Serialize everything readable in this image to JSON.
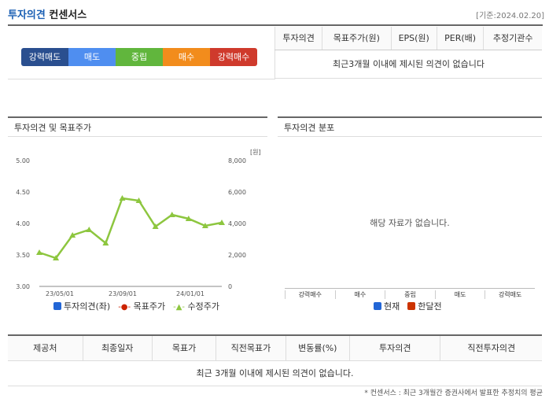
{
  "header": {
    "title_main": "투자의견",
    "title_sub": "컨센서스",
    "as_of": "[기준:2024.02.20]"
  },
  "rating_scale": {
    "items": [
      "강력매도",
      "매도",
      "중립",
      "매수",
      "강력매수"
    ],
    "colors": [
      "#2a4f8f",
      "#4f8ef0",
      "#61b63d",
      "#f28c1c",
      "#cf3a2c"
    ]
  },
  "consensus_table": {
    "columns": [
      "투자의견",
      "목표주가(원)",
      "EPS(원)",
      "PER(배)",
      "추정기관수"
    ],
    "empty_message": "최근3개월 이내에 제시된 의견이 없습니다"
  },
  "opinion_chart": {
    "panel_title": "투자의견 및 목표주가",
    "unit_label": "[원]",
    "legend": [
      "투자의견(좌)",
      "목표주가",
      "수정주가"
    ],
    "colors": {
      "opinion": "#2266d6",
      "target": "#cc2200",
      "price": "#8dc63f"
    }
  },
  "distribution_chart": {
    "panel_title": "투자의견 분포",
    "no_data": "해당 자료가 없습니다.",
    "categories": [
      "강력매수",
      "매수",
      "중립",
      "매도",
      "강력매도"
    ],
    "legend": [
      "현재",
      "한달전"
    ],
    "colors": {
      "current": "#2266d6",
      "month_ago": "#cc3300"
    }
  },
  "reports_table": {
    "columns": [
      "제공처",
      "최종일자",
      "목표가",
      "직전목표가",
      "변동률(%)",
      "투자의견",
      "직전투자의견"
    ],
    "empty_message": "최근 3개월 이내에 제시된 의견이 없습니다."
  },
  "footnote": "* 컨센서스 : 최근 3개월간 증권사에서 발표한 추정치의 평균",
  "chart_data": {
    "type": "line",
    "title": "투자의견 및 목표주가",
    "x": [
      "2023-03",
      "2023-04",
      "2023-05",
      "2023-06",
      "2023-07",
      "2023-08",
      "2023-09",
      "2023-10",
      "2023-11",
      "2023-12",
      "2024-01",
      "2024-02"
    ],
    "x_tick_labels": [
      "23/05/01",
      "23/09/01",
      "24/01/01"
    ],
    "series": [
      {
        "name": "수정주가",
        "axis": "right",
        "values": [
          2150,
          1800,
          3250,
          3600,
          2750,
          5600,
          5450,
          3800,
          4550,
          4300,
          3850,
          4050
        ]
      }
    ],
    "y_left": {
      "ticks": [
        "3.00",
        "3.50",
        "4.00",
        "4.50",
        "5.00"
      ],
      "ylim": [
        3.0,
        5.0
      ]
    },
    "y_right": {
      "ticks": [
        "0",
        "2,000",
        "4,000",
        "6,000",
        "8,000"
      ],
      "ylim": [
        0,
        8000
      ],
      "unit": "[원]"
    },
    "grid": false,
    "legend_position": "bottom"
  }
}
